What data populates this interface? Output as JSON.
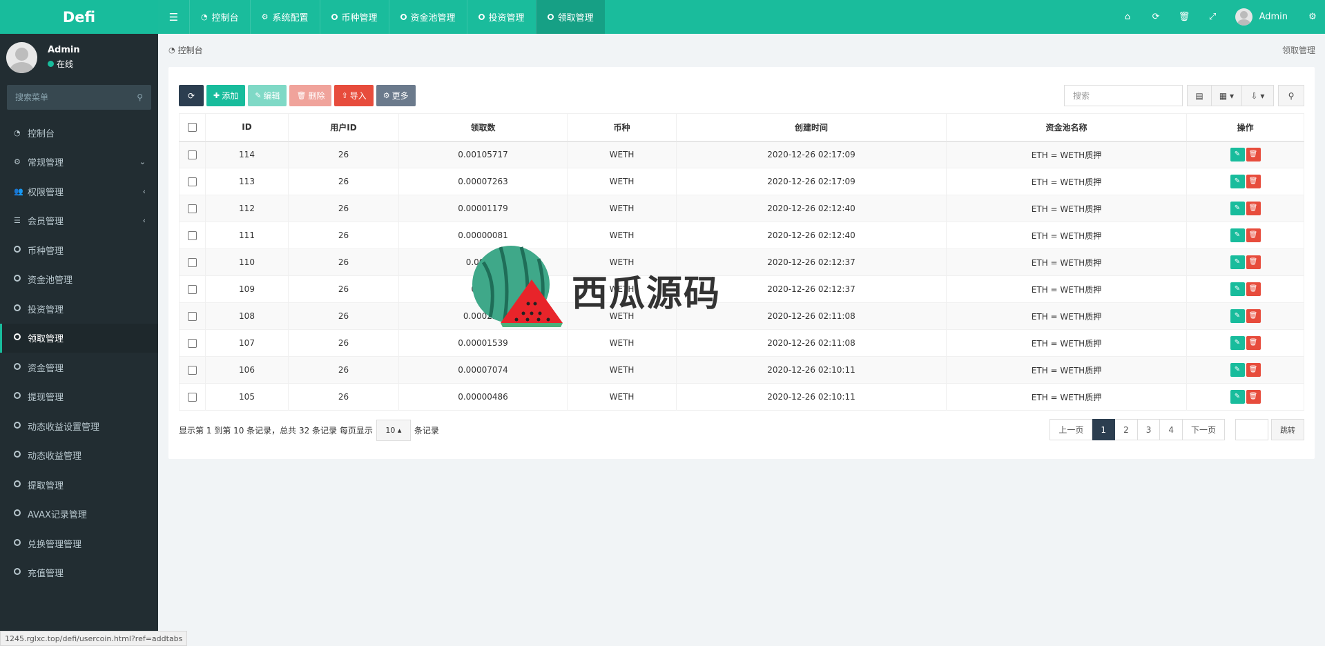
{
  "app": {
    "logo": "Defi"
  },
  "topnav": {
    "tabs": [
      {
        "label": "控制台",
        "icon": "dashboard-icon"
      },
      {
        "label": "系统配置",
        "icon": "gear-icon"
      },
      {
        "label": "币种管理",
        "icon": "circle-icon"
      },
      {
        "label": "资金池管理",
        "icon": "circle-icon"
      },
      {
        "label": "投资管理",
        "icon": "circle-icon"
      },
      {
        "label": "领取管理",
        "icon": "circle-icon",
        "active": true
      }
    ],
    "user": "Admin"
  },
  "sidebar": {
    "user": {
      "name": "Admin",
      "status": "在线"
    },
    "search_placeholder": "搜索菜单",
    "items": [
      {
        "label": "控制台"
      },
      {
        "label": "常规管理"
      },
      {
        "label": "权限管理"
      },
      {
        "label": "会员管理"
      },
      {
        "label": "币种管理"
      },
      {
        "label": "资金池管理"
      },
      {
        "label": "投资管理"
      },
      {
        "label": "领取管理",
        "active": true
      },
      {
        "label": "资金管理"
      },
      {
        "label": "提现管理"
      },
      {
        "label": "动态收益设置管理"
      },
      {
        "label": "动态收益管理"
      },
      {
        "label": "提取管理"
      },
      {
        "label": "AVAX记录管理"
      },
      {
        "label": "兑换管理管理"
      },
      {
        "label": "充值管理"
      }
    ]
  },
  "status_url": "1245.rglxc.top/defi/usercoin.html?ref=addtabs",
  "breadcrumb": {
    "left": "控制台",
    "right": "领取管理"
  },
  "toolbar": {
    "add": "添加",
    "edit": "编辑",
    "delete": "删除",
    "import": "导入",
    "more": "更多",
    "search_placeholder": "搜索"
  },
  "table": {
    "headers": [
      "ID",
      "用户ID",
      "领取数",
      "币种",
      "创建时间",
      "资金池名称",
      "操作"
    ],
    "rows": [
      [
        "114",
        "26",
        "0.00105717",
        "WETH",
        "2020-12-26 02:17:09",
        "ETH = WETH质押"
      ],
      [
        "113",
        "26",
        "0.00007263",
        "WETH",
        "2020-12-26 02:17:09",
        "ETH = WETH质押"
      ],
      [
        "112",
        "26",
        "0.00001179",
        "WETH",
        "2020-12-26 02:12:40",
        "ETH = WETH质押"
      ],
      [
        "111",
        "26",
        "0.00000081",
        "WETH",
        "2020-12-26 02:12:40",
        "ETH = WETH质押"
      ],
      [
        "110",
        "26",
        "0.00034",
        "WETH",
        "2020-12-26 02:12:37",
        "ETH = WETH质押"
      ],
      [
        "109",
        "26",
        "0.000",
        "WETH",
        "2020-12-26 02:12:37",
        "ETH = WETH质押"
      ],
      [
        "108",
        "26",
        "0.000224",
        "WETH",
        "2020-12-26 02:11:08",
        "ETH = WETH质押"
      ],
      [
        "107",
        "26",
        "0.00001539",
        "WETH",
        "2020-12-26 02:11:08",
        "ETH = WETH质押"
      ],
      [
        "106",
        "26",
        "0.00007074",
        "WETH",
        "2020-12-26 02:10:11",
        "ETH = WETH质押"
      ],
      [
        "105",
        "26",
        "0.00000486",
        "WETH",
        "2020-12-26 02:10:11",
        "ETH = WETH质押"
      ]
    ]
  },
  "pager": {
    "info_prefix": "显示第 1 到第 10 条记录，总共 32 条记录 每页显示",
    "page_size": "10",
    "info_suffix": "条记录",
    "prev": "上一页",
    "pages": [
      "1",
      "2",
      "3",
      "4"
    ],
    "current": "1",
    "next": "下一页",
    "jump": "跳转"
  },
  "watermark": {
    "text": "西瓜源码"
  },
  "colors": {
    "primary": "#18bc9c",
    "sidebar": "#222d32",
    "danger": "#e74c3c",
    "dark": "#2c3e50"
  }
}
